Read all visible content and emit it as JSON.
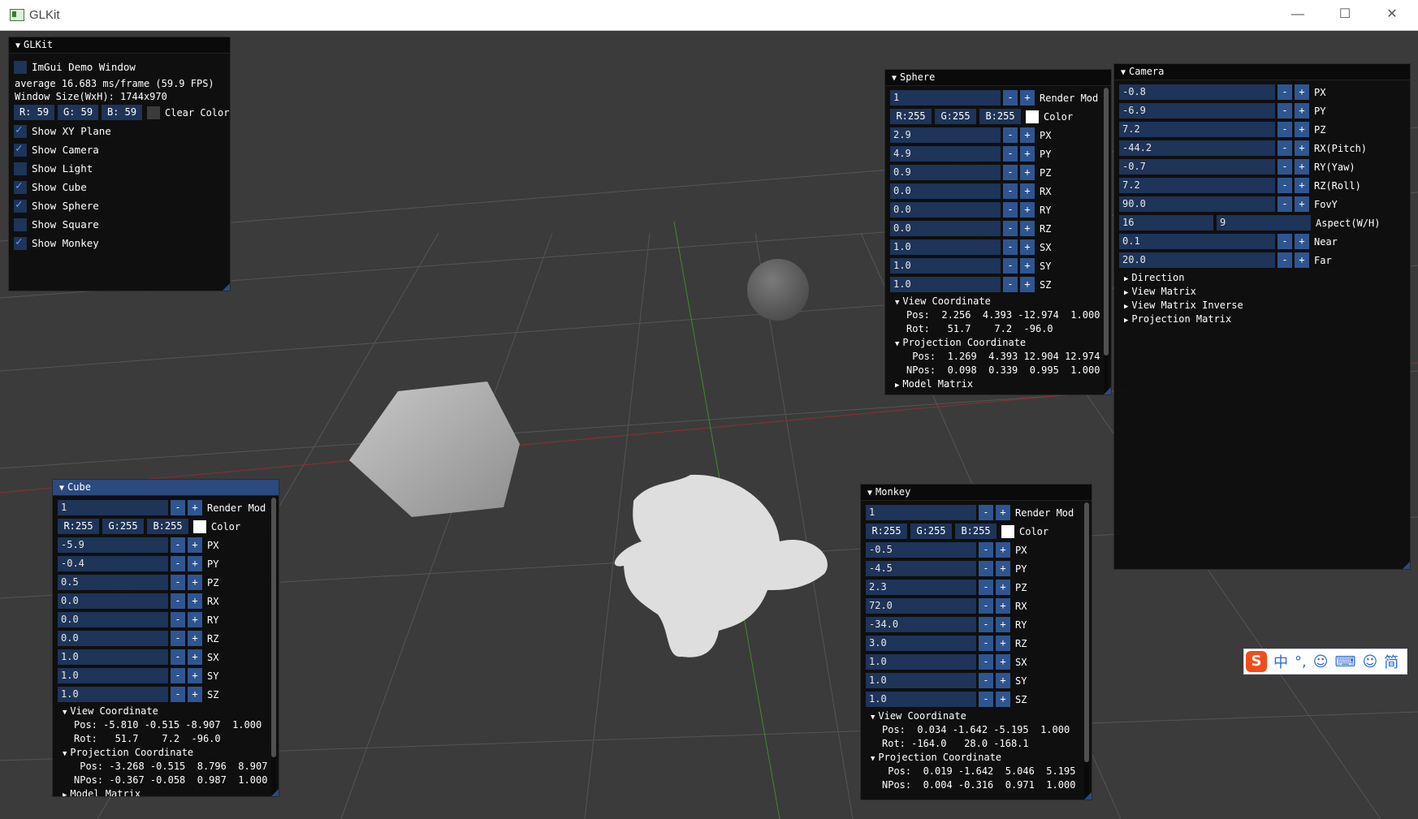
{
  "window": {
    "title": "GLKit",
    "minimize": "—",
    "maximize": "☐",
    "close": "✕"
  },
  "glkit": {
    "title": "GLKit",
    "demo_label": "ImGui Demo Window",
    "fps_text": "average 16.683 ms/frame (59.9 FPS)",
    "size_text": "Window Size(WxH): 1744x970",
    "clear": {
      "r": "R: 59",
      "g": "G: 59",
      "b": "B: 59",
      "label": "Clear Color",
      "color": "#3b3b3b"
    },
    "toggles": [
      {
        "label": "Show XY Plane",
        "checked": true
      },
      {
        "label": "Show Camera",
        "checked": true
      },
      {
        "label": "Show Light",
        "checked": false
      },
      {
        "label": "Show Cube",
        "checked": true
      },
      {
        "label": "Show Sphere",
        "checked": true
      },
      {
        "label": "Show Square",
        "checked": false
      },
      {
        "label": "Show Monkey",
        "checked": true
      }
    ]
  },
  "sphere": {
    "title": "Sphere",
    "render_mode": {
      "value": "1",
      "label": "Render Mod"
    },
    "color": {
      "r": "R:255",
      "g": "G:255",
      "b": "B:255",
      "label": "Color",
      "hex": "#ffffff"
    },
    "params": [
      {
        "value": "2.9",
        "label": "PX"
      },
      {
        "value": "4.9",
        "label": "PY"
      },
      {
        "value": "0.9",
        "label": "PZ"
      },
      {
        "value": "0.0",
        "label": "RX"
      },
      {
        "value": "0.0",
        "label": "RY"
      },
      {
        "value": "0.0",
        "label": "RZ"
      },
      {
        "value": "1.0",
        "label": "SX"
      },
      {
        "value": "1.0",
        "label": "SY"
      },
      {
        "value": "1.0",
        "label": "SZ"
      }
    ],
    "view_coord": {
      "header": "View Coordinate",
      "pos": "Pos:  2.256  4.393 -12.974  1.000",
      "rot": "Rot:   51.7    7.2  -96.0"
    },
    "proj_coord": {
      "header": "Projection Coordinate",
      "pos": " Pos:  1.269  4.393 12.904 12.974",
      "npos": "NPos:  0.098  0.339  0.995  1.000"
    },
    "model_matrix": "Model Matrix"
  },
  "camera": {
    "title": "Camera",
    "params": [
      {
        "value": "-0.8",
        "label": "PX"
      },
      {
        "value": "-6.9",
        "label": "PY"
      },
      {
        "value": "7.2",
        "label": "PZ"
      },
      {
        "value": "-44.2",
        "label": "RX(Pitch)"
      },
      {
        "value": "-0.7",
        "label": "RY(Yaw)"
      },
      {
        "value": "7.2",
        "label": "RZ(Roll)"
      },
      {
        "value": "90.0",
        "label": "FovY"
      }
    ],
    "aspect": {
      "w": "16",
      "h": "9",
      "label": "Aspect(W/H)"
    },
    "near": {
      "value": "0.1",
      "label": "Near"
    },
    "far": {
      "value": "20.0",
      "label": "Far"
    },
    "trees": [
      "Direction",
      "View Matrix",
      "View Matrix Inverse",
      "Projection Matrix"
    ]
  },
  "cube": {
    "title": "Cube",
    "render_mode": {
      "value": "1",
      "label": "Render Mod"
    },
    "color": {
      "r": "R:255",
      "g": "G:255",
      "b": "B:255",
      "label": "Color",
      "hex": "#ffffff"
    },
    "params": [
      {
        "value": "-5.9",
        "label": "PX"
      },
      {
        "value": "-0.4",
        "label": "PY"
      },
      {
        "value": "0.5",
        "label": "PZ"
      },
      {
        "value": "0.0",
        "label": "RX"
      },
      {
        "value": "0.0",
        "label": "RY"
      },
      {
        "value": "0.0",
        "label": "RZ"
      },
      {
        "value": "1.0",
        "label": "SX"
      },
      {
        "value": "1.0",
        "label": "SY"
      },
      {
        "value": "1.0",
        "label": "SZ"
      }
    ],
    "view_coord": {
      "header": "View Coordinate",
      "pos": "Pos: -5.810 -0.515 -8.907  1.000",
      "rot": "Rot:   51.7    7.2  -96.0"
    },
    "proj_coord": {
      "header": "Projection Coordinate",
      "pos": " Pos: -3.268 -0.515  8.796  8.907",
      "npos": "NPos: -0.367 -0.058  0.987  1.000"
    },
    "model_matrix": "Model Matrix"
  },
  "monkey": {
    "title": "Monkey",
    "render_mode": {
      "value": "1",
      "label": "Render Mod"
    },
    "color": {
      "r": "R:255",
      "g": "G:255",
      "b": "B:255",
      "label": "Color",
      "hex": "#ffffff"
    },
    "params": [
      {
        "value": "-0.5",
        "label": "PX"
      },
      {
        "value": "-4.5",
        "label": "PY"
      },
      {
        "value": "2.3",
        "label": "PZ"
      },
      {
        "value": "72.0",
        "label": "RX"
      },
      {
        "value": "-34.0",
        "label": "RY"
      },
      {
        "value": "3.0",
        "label": "RZ"
      },
      {
        "value": "1.0",
        "label": "SX"
      },
      {
        "value": "1.0",
        "label": "SY"
      },
      {
        "value": "1.0",
        "label": "SZ"
      }
    ],
    "view_coord": {
      "header": "View Coordinate",
      "pos": "Pos:  0.034 -1.642 -5.195  1.000",
      "rot": "Rot: -164.0   28.0 -168.1"
    },
    "proj_coord": {
      "header": "Projection Coordinate",
      "pos": " Pos:  0.019 -1.642  5.046  5.195",
      "npos": "NPos:  0.004 -0.316  0.971  1.000"
    },
    "model_matrix": "Model Matrix"
  },
  "buttons": {
    "minus": "-",
    "plus": "+"
  },
  "ime": {
    "lang": "中",
    "punct": "°,",
    "smile": "☺",
    "keyboard": "⌨",
    "user": "☺",
    "mode": "简",
    "logo": "S"
  }
}
